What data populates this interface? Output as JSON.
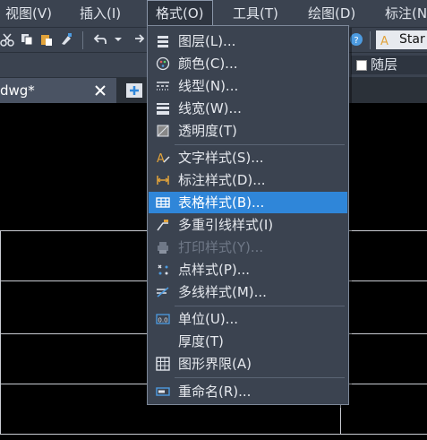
{
  "menubar": {
    "items": [
      "视图(V)",
      "插入(I)",
      "格式(O)",
      "工具(T)",
      "绘图(D)",
      "标注(N"
    ]
  },
  "toolbar": {
    "text_style": "Star"
  },
  "properties": {
    "layer_value": "随层"
  },
  "tab": {
    "title": "dwg*"
  },
  "format_menu": {
    "items": [
      {
        "label": "图层(L)...",
        "icon": "layers-icon"
      },
      {
        "label": "颜色(C)...",
        "icon": "palette-icon"
      },
      {
        "label": "线型(N)...",
        "icon": "linetype-icon"
      },
      {
        "label": "线宽(W)...",
        "icon": "lineweight-icon"
      },
      {
        "label": "透明度(T)",
        "icon": "transparency-icon"
      },
      {
        "label": "文字样式(S)...",
        "icon": "text-style-icon"
      },
      {
        "label": "标注样式(D)...",
        "icon": "dimension-style-icon"
      },
      {
        "label": "表格样式(B)...",
        "icon": "table-style-icon",
        "highlighted": true
      },
      {
        "label": "多重引线样式(I)",
        "icon": "multileader-style-icon"
      },
      {
        "label": "打印样式(Y)...",
        "icon": "plot-style-icon",
        "disabled": true
      },
      {
        "label": "点样式(P)...",
        "icon": "point-style-icon"
      },
      {
        "label": "多线样式(M)...",
        "icon": "multiline-style-icon"
      },
      {
        "label": "单位(U)...",
        "icon": "units-icon"
      },
      {
        "label": "厚度(T)",
        "icon": "thickness-icon"
      },
      {
        "label": "图形界限(A)",
        "icon": "drawing-limits-icon"
      },
      {
        "label": "重命名(R)...",
        "icon": "rename-icon"
      }
    ]
  },
  "colors": {
    "menu_bg": "#3b4350",
    "highlight": "#2f86d9",
    "canvas": "#000000"
  }
}
